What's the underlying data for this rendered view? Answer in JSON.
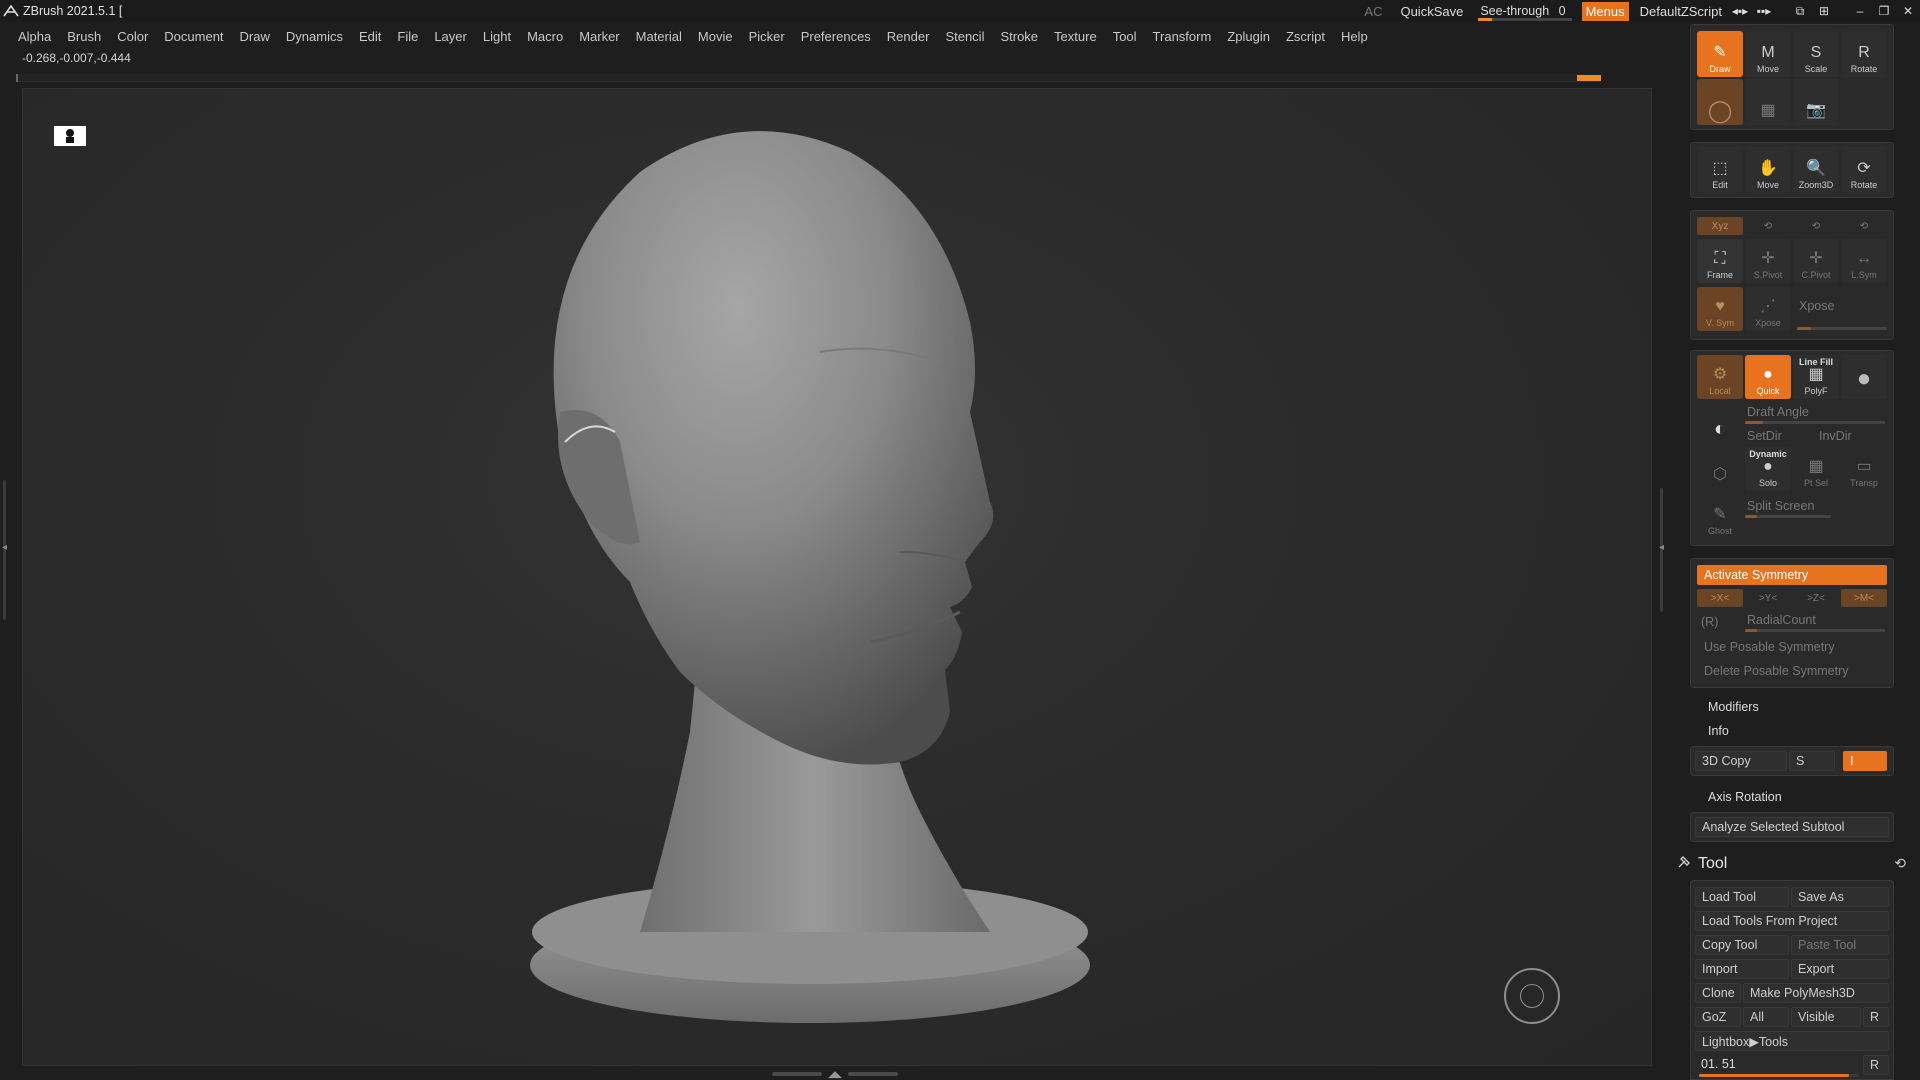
{
  "titlebar": {
    "title": "ZBrush 2021.5.1 [",
    "ac": "AC",
    "quicksave": "QuickSave",
    "seethrough_label": "See-through",
    "seethrough_value": "0",
    "seethrough_level": 0,
    "menus": "Menus",
    "script": "DefaultZScript"
  },
  "menubar": [
    "Alpha",
    "Brush",
    "Color",
    "Document",
    "Draw",
    "Dynamics",
    "Edit",
    "File",
    "Layer",
    "Light",
    "Macro",
    "Marker",
    "Material",
    "Movie",
    "Picker",
    "Preferences",
    "Render",
    "Stencil",
    "Stroke",
    "Texture",
    "Tool",
    "Transform",
    "Zplugin",
    "Zscript",
    "Help"
  ],
  "coords": "-0.268,-0.007,-0.444",
  "panel1": {
    "draw": "Draw",
    "move": "Move",
    "scale": "Scale",
    "rotate": "Rotate",
    "edit": "Edit"
  },
  "panel2": {
    "edit": "Edit",
    "move": "Move",
    "zoom": "Zoom3D",
    "rotate": "Rotate"
  },
  "panel3": {
    "xyz": "Xyz",
    "frame": "Frame",
    "spivot": "S.Pivot",
    "cpivot": "C.Pivot",
    "lsym": "L.Sym",
    "vsym": "V. Sym",
    "xpose_btn": "Xpose",
    "xpose_label": "Xpose"
  },
  "panel4": {
    "local": "Local",
    "quick": "Quick",
    "linefill": "Line Fill",
    "polyf": "PolyF",
    "draft_angle": "Draft Angle",
    "setdir": "SetDir",
    "invdir": "InvDir",
    "dynamic": "Dynamic",
    "solo": "Solo",
    "ptsel": "Pt Sel",
    "transp": "Transp",
    "ghost": "Ghost",
    "split_screen": "Split Screen"
  },
  "symmetry": {
    "activate": "Activate Symmetry",
    "x": ">X<",
    "y": ">Y<",
    "z": ">Z<",
    "m": ">M<",
    "r": "(R)",
    "radial": "RadialCount",
    "use_posable": "Use Posable Symmetry",
    "delete_posable": "Delete Posable Symmetry"
  },
  "misc": {
    "modifiers": "Modifiers",
    "info": "Info",
    "copy3d": "3D Copy",
    "s": "S",
    "i": "I",
    "axis_rotation": "Axis Rotation",
    "analyze": "Analyze Selected Subtool"
  },
  "tool": {
    "title": "Tool",
    "load_tool": "Load Tool",
    "save_as": "Save As",
    "load_from_project": "Load Tools From Project",
    "copy_tool": "Copy Tool",
    "paste_tool": "Paste Tool",
    "import": "Import",
    "export": "Export",
    "clone": "Clone",
    "make_polymesh": "Make PolyMesh3D",
    "goz": "GoZ",
    "all": "All",
    "visible": "Visible",
    "r": "R",
    "lightbox": "Lightbox▶Tools",
    "slider_value": "01. 51",
    "slider_r": "R"
  },
  "colors": {
    "accent": "#e8731e"
  }
}
